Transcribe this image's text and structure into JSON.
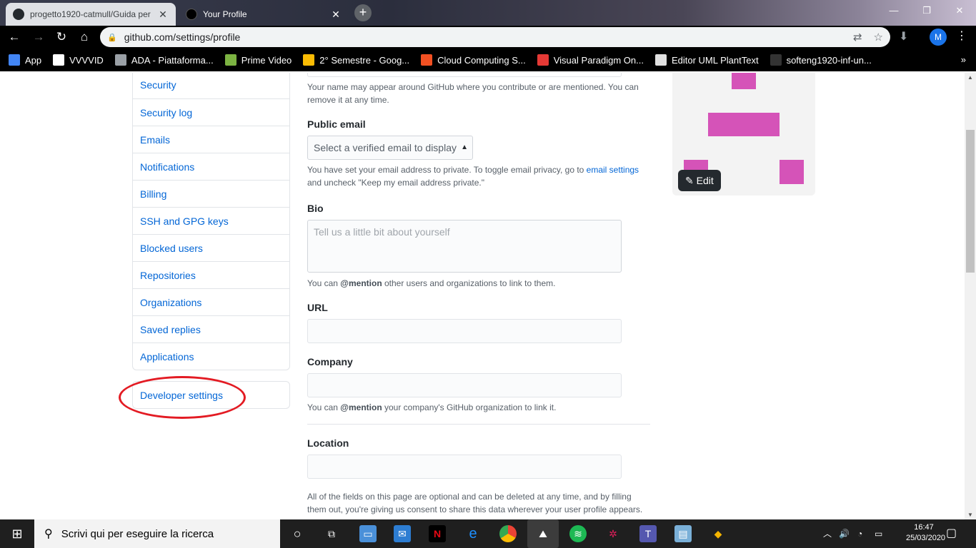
{
  "browser": {
    "tabs": [
      {
        "title": "progetto1920-catmull/Guida per",
        "active": false
      },
      {
        "title": "Your Profile",
        "active": true
      }
    ],
    "url": "github.com/settings/profile",
    "profile_initial": "M",
    "bookmarks": [
      {
        "label": "App",
        "color": "#4285f4"
      },
      {
        "label": "VVVVID",
        "color": "#ffffff"
      },
      {
        "label": "ADA - Piattaforma...",
        "color": "#9aa0a6"
      },
      {
        "label": "Prime Video",
        "color": "#7cb342"
      },
      {
        "label": "2° Semestre - Goog...",
        "color": "#fbbc04"
      },
      {
        "label": "Cloud Computing S...",
        "color": "#f25022"
      },
      {
        "label": "Visual Paradigm On...",
        "color": "#e53935"
      },
      {
        "label": "Editor UML PlantText",
        "color": "#e0e0e0"
      },
      {
        "label": "softeng1920-inf-un...",
        "color": "#333333"
      }
    ]
  },
  "sidebar": {
    "items": [
      "Security",
      "Security log",
      "Emails",
      "Notifications",
      "Billing",
      "SSH and GPG keys",
      "Blocked users",
      "Repositories",
      "Organizations",
      "Saved replies",
      "Applications"
    ],
    "developer_settings": "Developer settings"
  },
  "form": {
    "name_note": "Your name may appear around GitHub where you contribute or are mentioned. You can remove it at any time.",
    "public_email_label": "Public email",
    "public_email_select": "Select a verified email to display",
    "email_note_pre": "You have set your email address to private. To toggle email privacy, go to",
    "email_note_link": "email settings",
    "email_note_post": "and uncheck \"Keep my email address private.\"",
    "bio_label": "Bio",
    "bio_placeholder": "Tell us a little bit about yourself",
    "bio_note_pre": "You can",
    "bio_note_mention": "@mention",
    "bio_note_post": "other users and organizations to link to them.",
    "url_label": "URL",
    "company_label": "Company",
    "company_note_pre": "You can",
    "company_note_mention": "@mention",
    "company_note_post": "your company's GitHub organization to link it.",
    "location_label": "Location",
    "footer_note": "All of the fields on this page are optional and can be deleted at any time, and by filling them out, you're giving us consent to share this data wherever your user profile appears."
  },
  "avatar": {
    "edit_label": "Edit",
    "pixel_color": "#d553b8"
  },
  "taskbar": {
    "search_placeholder": "Scrivi qui per eseguire la ricerca",
    "time": "16:47",
    "date": "25/03/2020"
  }
}
